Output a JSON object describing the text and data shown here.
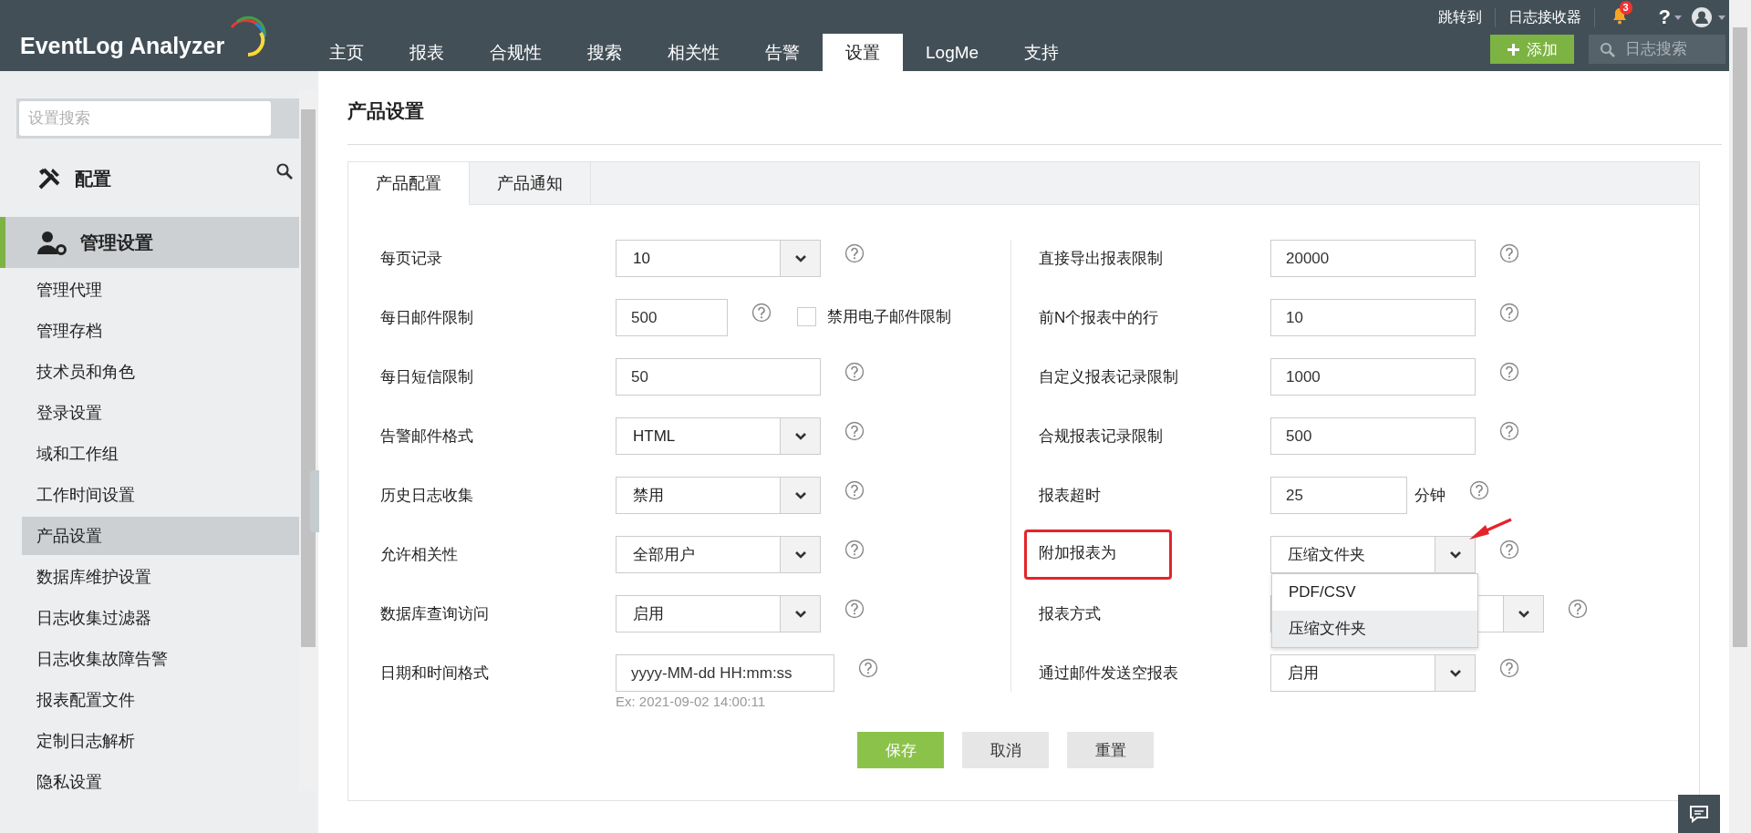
{
  "header": {
    "logo": "EventLog Analyzer",
    "top_links": [
      "跳转到",
      "日志接收器"
    ],
    "notification_count": "3",
    "help": "?",
    "add_button": "添加",
    "search": {
      "placeholder": "日志搜索"
    },
    "nav": [
      {
        "label": "主页",
        "selected": false
      },
      {
        "label": "报表",
        "selected": false
      },
      {
        "label": "合规性",
        "selected": false
      },
      {
        "label": "搜索",
        "selected": false
      },
      {
        "label": "相关性",
        "selected": false
      },
      {
        "label": "告警",
        "selected": false
      },
      {
        "label": "设置",
        "selected": true
      },
      {
        "label": "LogMe",
        "selected": false
      },
      {
        "label": "支持",
        "selected": false
      }
    ]
  },
  "sidebar": {
    "search": {
      "placeholder": "设置搜索"
    },
    "sections": [
      {
        "label": "配置",
        "selected": false
      },
      {
        "label": "管理设置",
        "selected": true,
        "children": [
          {
            "label": "管理代理",
            "selected": false
          },
          {
            "label": "管理存档",
            "selected": false
          },
          {
            "label": "技术员和角色",
            "selected": false
          },
          {
            "label": "登录设置",
            "selected": false
          },
          {
            "label": "域和工作组",
            "selected": false
          },
          {
            "label": "工作时间设置",
            "selected": false
          },
          {
            "label": "产品设置",
            "selected": true
          },
          {
            "label": "数据库维护设置",
            "selected": false
          },
          {
            "label": "日志收集过滤器",
            "selected": false
          },
          {
            "label": "日志收集故障告警",
            "selected": false
          },
          {
            "label": "报表配置文件",
            "selected": false
          },
          {
            "label": "定制日志解析",
            "selected": false
          },
          {
            "label": "隐私设置",
            "selected": false
          }
        ]
      }
    ]
  },
  "page": {
    "title": "产品设置",
    "tabs": [
      {
        "label": "产品配置",
        "selected": true
      },
      {
        "label": "产品通知",
        "selected": false
      }
    ],
    "left_fields": [
      {
        "label": "每页记录",
        "kind": "select",
        "value": "10"
      },
      {
        "label": "每日邮件限制",
        "kind": "text_checkbox",
        "value": "500",
        "checkbox": {
          "label": "禁用电子邮件限制",
          "checked": false
        }
      },
      {
        "label": "每日短信限制",
        "kind": "text",
        "value": "50"
      },
      {
        "label": "告警邮件格式",
        "kind": "select",
        "value": "HTML"
      },
      {
        "label": "历史日志收集",
        "kind": "select",
        "value": "禁用"
      },
      {
        "label": "允许相关性",
        "kind": "select",
        "value": "全部用户"
      },
      {
        "label": "数据库查询访问",
        "kind": "select",
        "value": "启用"
      },
      {
        "label": "日期和时间格式",
        "kind": "text_hint",
        "value": "yyyy-MM-dd HH:mm:ss",
        "hint": "Ex: 2021-09-02 14:00:11"
      }
    ],
    "right_fields": [
      {
        "label": "直接导出报表限制",
        "kind": "text",
        "value": "20000"
      },
      {
        "label": "前N个报表中的行",
        "kind": "text",
        "value": "10"
      },
      {
        "label": "自定义报表记录限制",
        "kind": "text",
        "value": "1000"
      },
      {
        "label": "合规报表记录限制",
        "kind": "text",
        "value": "500"
      },
      {
        "label": "报表超时",
        "kind": "text_unit",
        "value": "25",
        "unit": "分钟"
      },
      {
        "label": "附加报表为",
        "kind": "select",
        "value": "压缩文件夹",
        "highlighted": true,
        "menu": {
          "options": [
            {
              "label": "PDF/CSV",
              "selected": false
            },
            {
              "label": "压缩文件夹",
              "selected": true
            }
          ]
        }
      },
      {
        "label": "报表方式",
        "kind": "select_wide"
      },
      {
        "label": "通过邮件发送空报表",
        "kind": "select",
        "value": "启用"
      }
    ],
    "buttons": [
      {
        "label": "保存",
        "kind": "primary"
      },
      {
        "label": "取消",
        "kind": "secondary"
      },
      {
        "label": "重置",
        "kind": "secondary"
      }
    ]
  }
}
